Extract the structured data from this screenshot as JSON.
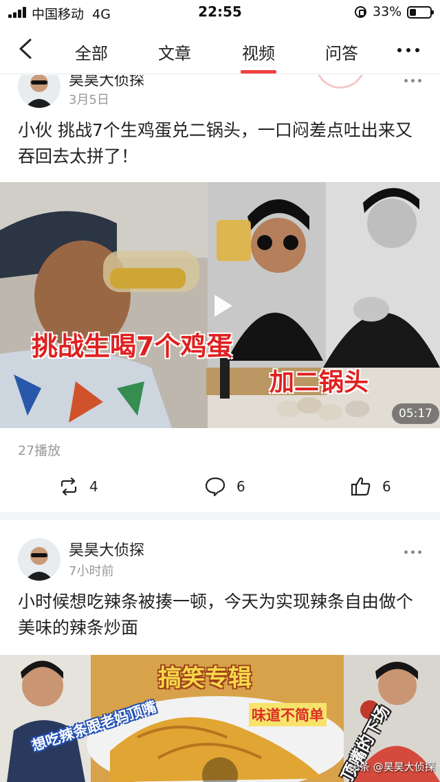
{
  "status_bar": {
    "carrier": "中国移动",
    "network": "4G",
    "time": "22:55",
    "battery": "33%",
    "battery_level": 0.33
  },
  "nav": {
    "tabs": [
      "全部",
      "文章",
      "视频",
      "问答"
    ],
    "active_tab": "视频",
    "accent_color": "#f04142"
  },
  "posts": [
    {
      "author": "昊昊大侦探",
      "time": "3月5日",
      "title": "小伙 挑战7个生鸡蛋兑二锅头，一口闷差点吐出来又吞回去太拼了！",
      "video": {
        "overlay_left": "挑战生喝7个鸡蛋",
        "overlay_right": "加二锅头",
        "duration": "05:17"
      },
      "plays": "27播放",
      "reposts": "4",
      "comments": "6",
      "likes": "6"
    },
    {
      "author": "昊昊大侦探",
      "time": "7小时前",
      "title": "小时候想吃辣条被揍一顿，今天为实现辣条自由做个美味的辣条炒面",
      "video": {
        "banner": "搞笑专辑",
        "overlay_a": "想吃辣条跟老妈顶嘴",
        "overlay_b": "味道不简单",
        "overlay_c": "顶嘴的下场",
        "watermark": "头条 @昊昊大侦探"
      }
    }
  ]
}
